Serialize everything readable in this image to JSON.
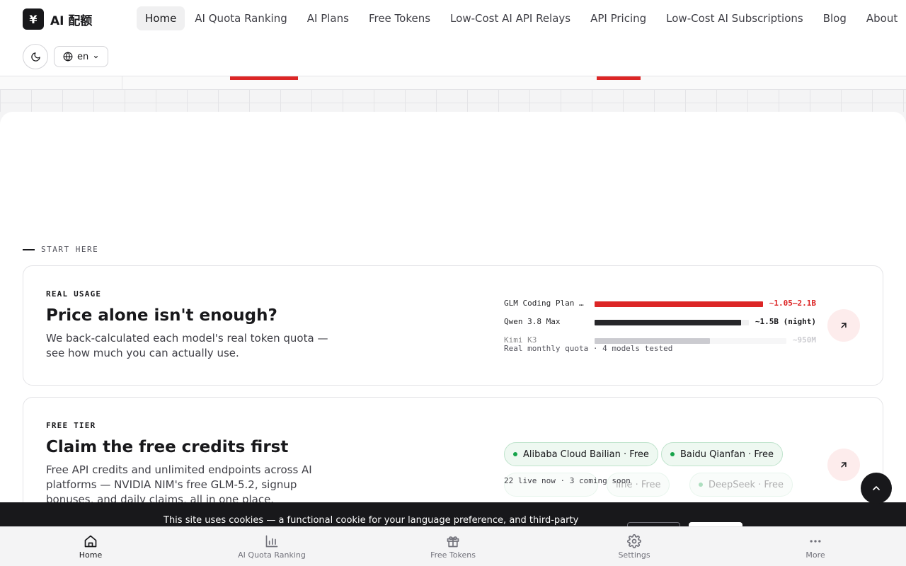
{
  "brand": {
    "mark": "¥",
    "name": "AI 配额"
  },
  "nav": {
    "items": [
      {
        "label": "Home",
        "active": true
      },
      {
        "label": "AI Quota Ranking"
      },
      {
        "label": "AI Plans"
      },
      {
        "label": "Free Tokens"
      },
      {
        "label": "Low-Cost AI API Relays"
      },
      {
        "label": "API Pricing"
      },
      {
        "label": "Low-Cost AI Subscriptions"
      },
      {
        "label": "Blog"
      },
      {
        "label": "About"
      }
    ]
  },
  "controls": {
    "theme_icon": "moon-icon",
    "language": "en"
  },
  "section": {
    "label": "START HERE"
  },
  "cards": [
    {
      "eyebrow": "REAL USAGE",
      "title": "Price alone isn't enough?",
      "desc": "We back-calculated each model's real token quota — see how much you can actually use.",
      "quota": [
        {
          "label": "GLM Coding Plan …",
          "value": "~1.05–2.1B",
          "fill": 1.0,
          "color": "#dc2626",
          "valueColor": "#dc2626"
        },
        {
          "label": "Qwen 3.8 Max",
          "value": "~1.5B (night)",
          "fill": 0.95,
          "color": "#27272a",
          "valueColor": "#18181b"
        },
        {
          "label": "Kimi K3",
          "value": "~950M",
          "fill": 0.6,
          "color": "#a1a1aa",
          "valueColor": "#a1a1aa"
        }
      ],
      "footer": "Real monthly quota · 4 models tested"
    },
    {
      "eyebrow": "FREE TIER",
      "title": "Claim the free credits first",
      "desc": "Free API credits and unlimited endpoints across AI platforms — NVIDIA NIM's free GLM-5.2, signup bonuses, and daily claims, all in one place.",
      "chips": [
        {
          "label": "Alibaba Cloud Bailian · Free"
        },
        {
          "label": "Baidu Qianfan · Free"
        },
        {
          "label": "line · Free"
        },
        {
          "label": "DeepSeek · Free"
        }
      ],
      "footer": "22 live now · 3 coming soon"
    }
  ],
  "cookie": {
    "text": "This site uses cookies — a functional cookie for your language preference, and third-party"
  },
  "tabbar": [
    {
      "label": "Home",
      "icon": "home-icon",
      "active": true
    },
    {
      "label": "AI Quota Ranking",
      "icon": "bar-chart-icon"
    },
    {
      "label": "Free Tokens",
      "icon": "gift-icon"
    },
    {
      "label": "Settings",
      "icon": "gear-icon"
    },
    {
      "label": "More",
      "icon": "more-icon"
    }
  ]
}
